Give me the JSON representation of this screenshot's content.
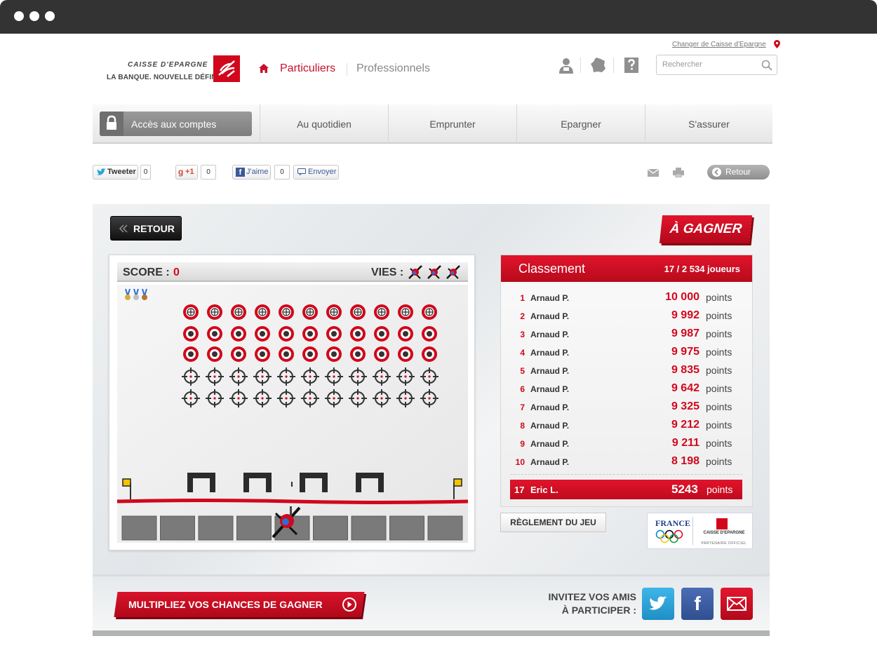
{
  "header": {
    "change_link": "Changer de Caisse d'Epargne",
    "logo_line1": "CAISSE D'EPARGNE",
    "logo_line2": "LA BANQUE. NOUVELLE DÉFINITION.",
    "nav_particuliers": "Particuliers",
    "nav_professionnels": "Professionnels",
    "search_placeholder": "Rechercher"
  },
  "main_nav": {
    "access_label": "Accès aux comptes",
    "items": [
      "Au quotidien",
      "Emprunter",
      "Epargner",
      "S'assurer"
    ]
  },
  "social": {
    "tweet_label": "Tweeter",
    "tweet_count": "0",
    "gplus_label": "+1",
    "gplus_count": "0",
    "fb_label": "J'aime",
    "fb_count": "0",
    "send_label": "Envoyer",
    "retour_label": "Retour"
  },
  "game": {
    "retour_label": "RETOUR",
    "a_gagner_label": "À GAGNER",
    "score_label": "SCORE :",
    "score_value": "0",
    "lives_label": "VIES :",
    "lives": 3
  },
  "ranking": {
    "title": "Classement",
    "players": "17 / 2 534 joueurs",
    "unit": "points",
    "rows": [
      {
        "pos": "1",
        "name": "Arnaud P.",
        "score": "10 000"
      },
      {
        "pos": "2",
        "name": "Arnaud P.",
        "score": "9 992"
      },
      {
        "pos": "3",
        "name": "Arnaud P.",
        "score": "9 987"
      },
      {
        "pos": "4",
        "name": "Arnaud P.",
        "score": "9 975"
      },
      {
        "pos": "5",
        "name": "Arnaud P.",
        "score": "9 835"
      },
      {
        "pos": "6",
        "name": "Arnaud P.",
        "score": "9 642"
      },
      {
        "pos": "7",
        "name": "Arnaud P.",
        "score": "9 325"
      },
      {
        "pos": "8",
        "name": "Arnaud P.",
        "score": "9 212"
      },
      {
        "pos": "9",
        "name": "Arnaud P.",
        "score": "9 211"
      },
      {
        "pos": "10",
        "name": "Arnaud P.",
        "score": "8 198"
      }
    ],
    "me": {
      "pos": "17",
      "name": "Eric L.",
      "score": "5243"
    },
    "rules_label": "RÈGLEMENT DU JEU"
  },
  "partner": {
    "france": "FRANCE",
    "brand": "CAISSE D'EPARGNE",
    "tagline": "PARTENAIRE OFFICIEL"
  },
  "bottom": {
    "multiplier_label": "MULTIPLIEZ VOS CHANCES DE GAGNER",
    "invite_line1": "INVITEZ VOS AMIS",
    "invite_line2": "À PARTICIPER :"
  },
  "colors": {
    "brand_red": "#d1081c",
    "twitter": "#2aa4d8",
    "facebook": "#3b5998",
    "mail": "#d1081c"
  }
}
